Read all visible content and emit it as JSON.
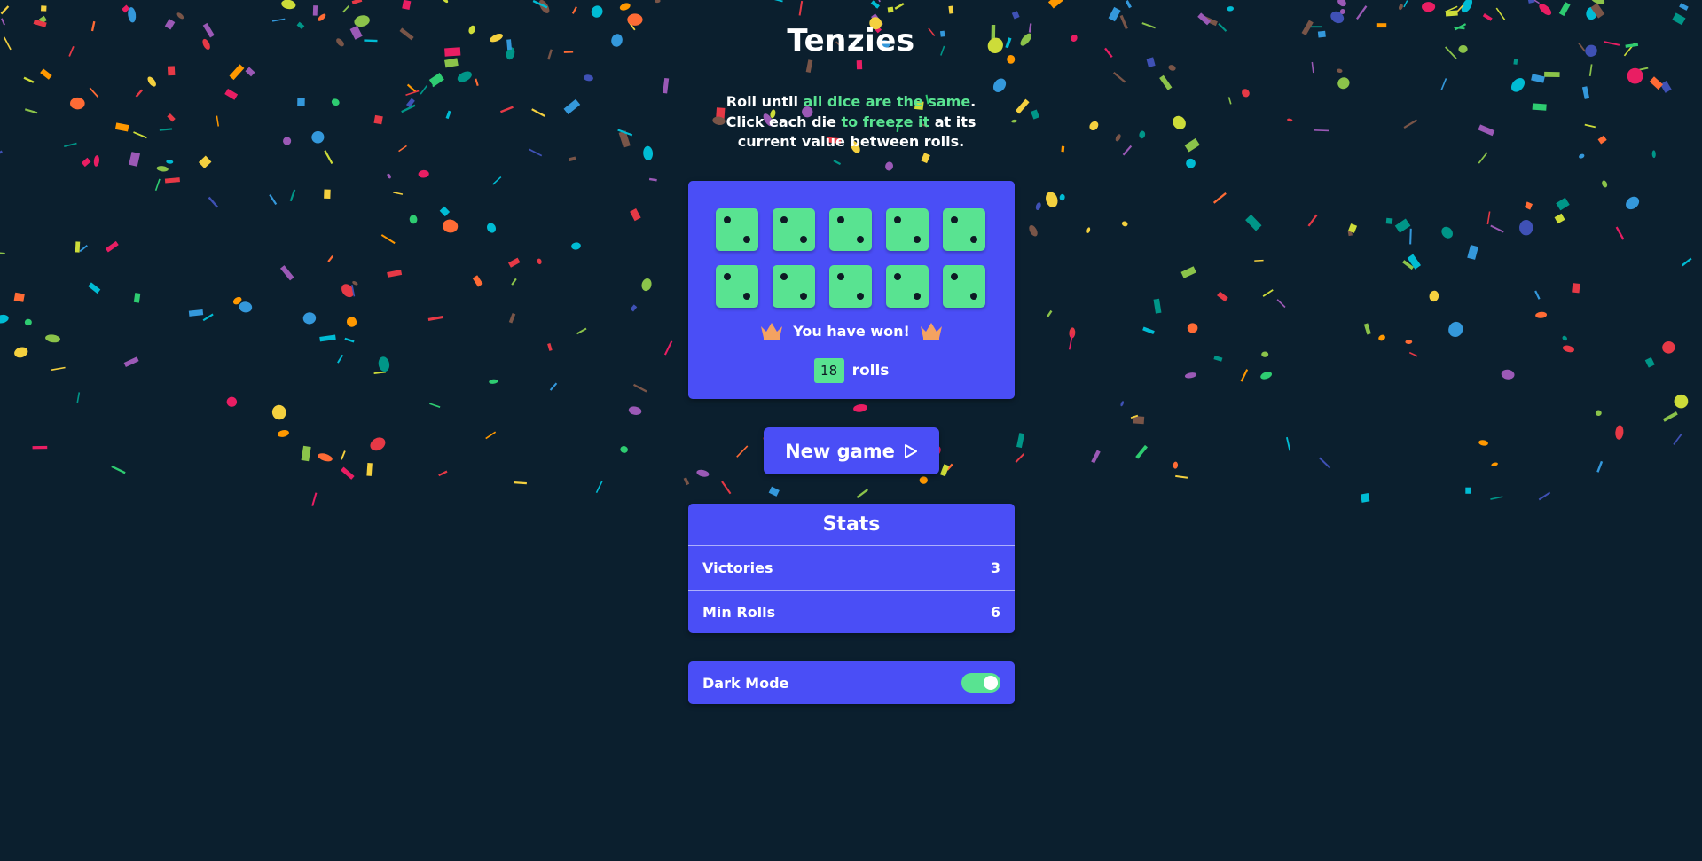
{
  "app": {
    "title": "Tenzies"
  },
  "instructions": {
    "part1": "Roll until ",
    "highlight1": "all dice are the same",
    "part2": ".",
    "part3": "Click each die ",
    "highlight2": "to freeze it",
    "part4": " at its",
    "part5": "current value between rolls."
  },
  "board": {
    "dice": [
      2,
      2,
      2,
      2,
      2,
      2,
      2,
      2,
      2,
      2
    ],
    "won_text": "You have won!",
    "roll_count": "18",
    "rolls_label": "rolls"
  },
  "new_game": {
    "label": "New game"
  },
  "stats": {
    "title": "Stats",
    "rows": [
      {
        "label": "Victories",
        "value": "3"
      },
      {
        "label": "Min Rolls",
        "value": "6"
      }
    ]
  },
  "settings": {
    "dark_mode_label": "Dark Mode",
    "dark_mode_on": true
  },
  "colors": {
    "background": "#0b1f2e",
    "panel": "#4a4ef6",
    "accent_green": "#59e391",
    "crown": "#f4a261"
  },
  "icons": {
    "crown": "crown-icon",
    "play": "play-icon"
  }
}
